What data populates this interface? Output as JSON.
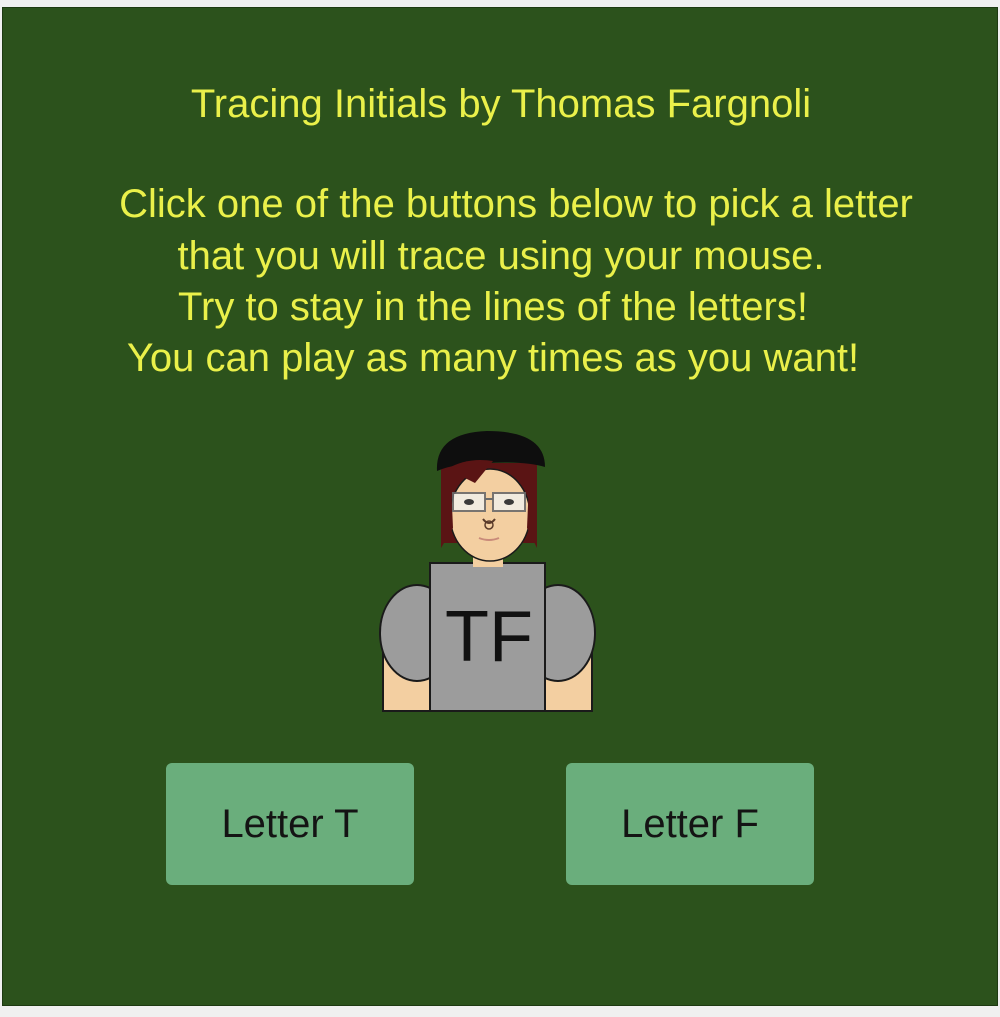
{
  "title": "Tracing Initials by Thomas Fargnoli",
  "instructions": [
    "Click one of the buttons below to pick a letter",
    "that you will trace using your mouse.",
    "Try to stay in the lines of the letters!",
    "You can play as many times as you want!"
  ],
  "avatar": {
    "shirt_text": "TF",
    "shirt_color": "#9c9c9c",
    "skin_color": "#f3cfa1",
    "hair_color": "#5a1414"
  },
  "buttons": {
    "letter_t": "Letter T",
    "letter_f": "Letter F",
    "color": "#6aae7c"
  },
  "colors": {
    "background": "#2c521c",
    "text": "#eaf04a"
  }
}
